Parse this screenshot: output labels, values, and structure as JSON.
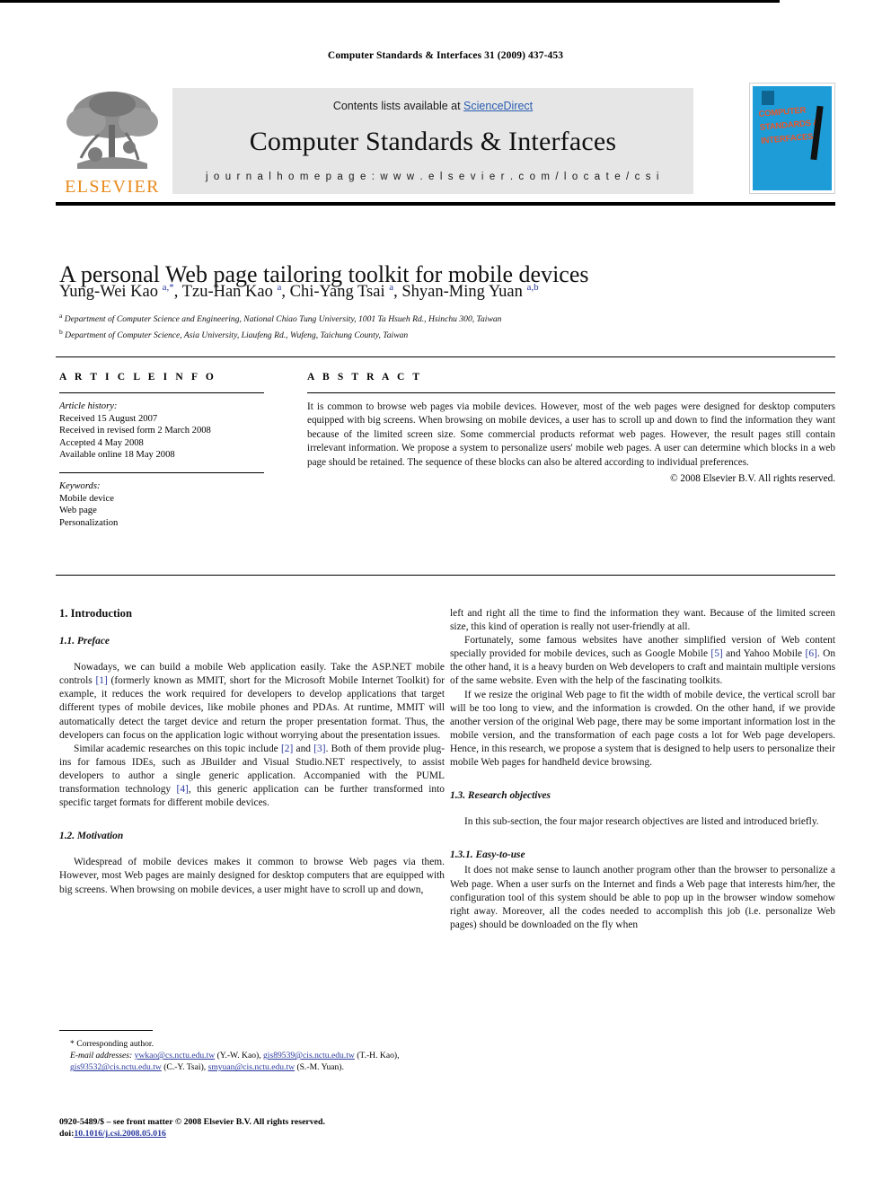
{
  "running_head": "Computer Standards & Interfaces 31 (2009) 437-453",
  "masthead": {
    "publisher_logo_text": "ELSEVIER",
    "contents_prefix": "Contents lists available at ",
    "contents_link": "ScienceDirect",
    "journal_name": "Computer Standards & Interfaces",
    "homepage_line": "j o u r n a l   h o m e p a g e :   w w w . e l s e v i e r . c o m / l o c a t e / c s i",
    "cover_title": "COMPUTER STANDARDS & INTERFACES",
    "cover_bg_color": "#1E9CD7",
    "cover_text_color": "#E8552A",
    "logo_color": "#E88A1A",
    "link_color": "#2a5db0"
  },
  "article": {
    "title": "A personal Web page tailoring toolkit for mobile devices",
    "authors": "Yung-Wei Kao a,*, Tzu-Han Kao a, Chi-Yang Tsai a, Shyan-Ming Yuan a,b",
    "affiliation_a": "Department of Computer Science and Engineering, National Chiao Tung University, 1001 Ta Hsueh Rd., Hsinchu 300, Taiwan",
    "affiliation_b": "Department of Computer Science, Asia University, Liaufeng Rd., Wufeng, Taichung County, Taiwan"
  },
  "article_info": {
    "heading": "A R T I C L E   I N F O",
    "history_label": "Article history:",
    "history": [
      "Received 15 August 2007",
      "Received in revised form 2 March 2008",
      "Accepted 4 May 2008",
      "Available online 18 May 2008"
    ],
    "keywords_label": "Keywords:",
    "keywords": [
      "Mobile device",
      "Web page",
      "Personalization"
    ]
  },
  "abstract": {
    "heading": "A B S T R A C T",
    "body": "It is common to browse web pages via mobile devices. However, most of the web pages were designed for desktop computers equipped with big screens. When browsing on mobile devices, a user has to scroll up and down to find the information they want because of the limited screen size. Some commercial products reformat web pages. However, the result pages still contain irrelevant information. We propose a system to personalize users' mobile web pages. A user can determine which blocks in a web page should be retained. The sequence of these blocks can also be altered according to individual preferences.",
    "copyright": "© 2008 Elsevier B.V. All rights reserved."
  },
  "body": {
    "section_1": "1. Introduction",
    "subsection_1_1": "1.1. Preface",
    "para_1_1_a_part1": "Nowadays, we can build a mobile Web application easily. Take the ASP.NET mobile controls ",
    "para_1_1_a_ref1": "[1]",
    "para_1_1_a_part2": " (formerly known as MMIT, short for the Microsoft Mobile Internet Toolkit) for example, it reduces the work required for developers to develop applications that target different types of mobile devices, like mobile phones and PDAs. At runtime, MMIT will automatically detect the target device and return the proper presentation format. Thus, the developers can focus on the application logic without worrying about the presentation issues.",
    "para_1_1_b_part1": "Similar academic researches on this topic include ",
    "para_1_1_b_ref1": "[2]",
    "para_1_1_b_part2": " and ",
    "para_1_1_b_ref2": "[3]",
    "para_1_1_b_part3": ". Both of them provide plug-ins for famous IDEs, such as JBuilder and Visual Studio.NET respectively, to assist developers to author a single generic application. Accompanied with the PUML transformation technology ",
    "para_1_1_b_ref3": "[4]",
    "para_1_1_b_part4": ", this generic application can be further transformed into specific target formats for different mobile devices.",
    "subsection_1_2": "1.2. Motivation",
    "para_1_2_a": "Widespread of mobile devices makes it common to browse Web pages via them. However, most Web pages are mainly designed for desktop computers that are equipped with big screens. When browsing on mobile devices, a user might have to scroll up and down,",
    "para_1_2_cont": "left and right all the time to find the information they want. Because of the limited screen size, this kind of operation is really not user-friendly at all.",
    "para_1_2_b_part1": "Fortunately, some famous websites have another simplified version of Web content specially provided for mobile devices, such as Google Mobile ",
    "para_1_2_b_ref1": "[5]",
    "para_1_2_b_part2": " and Yahoo Mobile ",
    "para_1_2_b_ref2": "[6]",
    "para_1_2_b_part3": ". On the other hand, it is a heavy burden on Web developers to craft and maintain multiple versions of the same website. Even with the help of the fascinating toolkits.",
    "para_1_2_c": "If we resize the original Web page to fit the width of mobile device, the vertical scroll bar will be too long to view, and the information is crowded. On the other hand, if we provide another version of the original Web page, there may be some important information lost in the mobile version, and the transformation of each page costs a lot for Web page developers. Hence, in this research, we propose a system that is designed to help users to personalize their mobile Web pages for handheld device browsing.",
    "subsection_1_3": "1.3. Research objectives",
    "para_1_3_a": "In this sub-section, the four major research objectives are listed and introduced briefly.",
    "subsection_1_3_1": "1.3.1. Easy-to-use",
    "para_1_3_1_a": "It does not make sense to launch another program other than the browser to personalize a Web page. When a user surfs on the Internet and finds a Web page that interests him/her, the configuration tool of this system should be able to pop up in the browser window somehow right away. Moreover, all the codes needed to accomplish this job (i.e. personalize Web pages) should be downloaded on the fly when"
  },
  "footnotes": {
    "corresponding": "* Corresponding author.",
    "email_label": "E-mail addresses:",
    "email_1": "ywkao@cs.nctu.edu.tw",
    "email_1_who": " (Y.-W. Kao), ",
    "email_2": "gis89539@cis.nctu.edu.tw",
    "email_2_who": " (T.-H. Kao), ",
    "email_3": "gis93532@cis.nctu.edu.tw",
    "email_3_who": " (C.-Y. Tsai), ",
    "email_4": "smyuan@cis.nctu.edu.tw",
    "email_4_who": " (S.-M. Yuan)."
  },
  "imprint": {
    "issn_line": "0920-5489/$ – see front matter © 2008 Elsevier B.V. All rights reserved.",
    "doi_label": "doi:",
    "doi_value": "10.1016/j.csi.2008.05.016"
  }
}
